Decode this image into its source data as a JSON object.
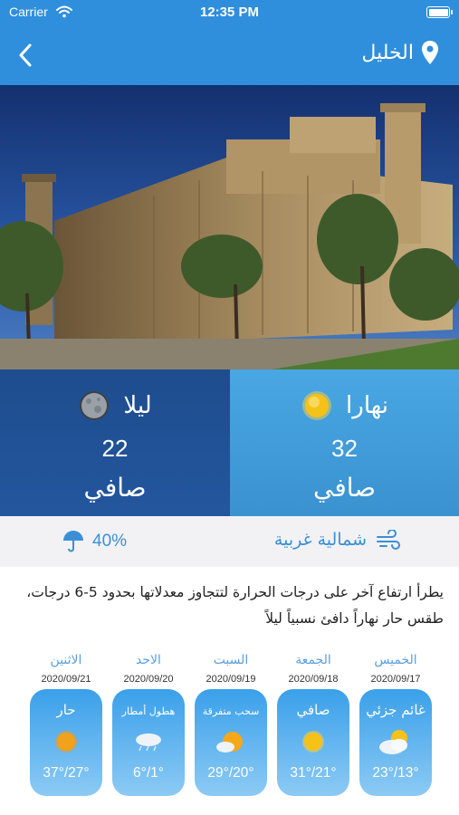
{
  "status": {
    "carrier": "Carrier",
    "time": "12:35 PM"
  },
  "nav": {
    "title": "الخليل"
  },
  "day_panel": {
    "label": "نهارا",
    "temp": "32",
    "condition": "صافي"
  },
  "night_panel": {
    "label": "ليلا",
    "temp": "22",
    "condition": "صافي"
  },
  "info": {
    "wind": "شمالية غربية",
    "rain": "40%"
  },
  "forecast_text": "يطرأ ارتفاع آخر على درجات الحرارة لتتجاوز معدلاتها بحدود 5-6 درجات، طقس حار نهاراً دافئ نسبياً ليلاً",
  "days": [
    {
      "name": "الخميس",
      "date": "2020/09/17",
      "condition": "غائم جزئي",
      "range": "23°/13°",
      "icon": "partly-cloudy-icon"
    },
    {
      "name": "الجمعة",
      "date": "2020/09/18",
      "condition": "صافي",
      "range": "31°/21°",
      "icon": "sun-icon"
    },
    {
      "name": "السبت",
      "date": "2020/09/19",
      "condition": "سحب متفرقة",
      "range": "29°/20°",
      "icon": "scattered-clouds-icon"
    },
    {
      "name": "الاحد",
      "date": "2020/09/20",
      "condition": "هطول أمطار",
      "range": "6°/1°",
      "icon": "rain-cloud-icon"
    },
    {
      "name": "الاثنين",
      "date": "2020/09/21",
      "condition": "حار",
      "range": "37°/27°",
      "icon": "hot-sun-icon"
    }
  ],
  "colors": {
    "nav": "#2f8fdc",
    "day_panel": "#49a7e3",
    "night_panel": "#1e4d8e",
    "accent_text": "#3b8fd6"
  }
}
